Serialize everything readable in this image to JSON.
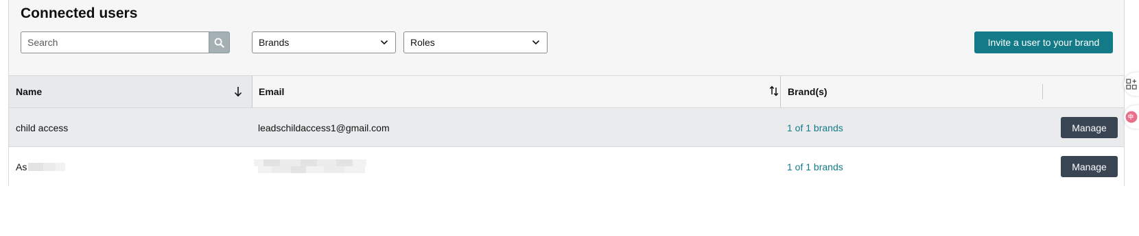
{
  "page": {
    "title": "Connected users"
  },
  "filters": {
    "search_placeholder": "Search",
    "brands_label": "Brands",
    "roles_label": "Roles",
    "invite_label": "Invite a user to your brand"
  },
  "table": {
    "columns": {
      "name": "Name",
      "email": "Email",
      "brands": "Brand(s)"
    },
    "rows": [
      {
        "name": "child access",
        "email": "leadschildaccess1@gmail.com",
        "brands": "1 of 1 brands",
        "action": "Manage"
      },
      {
        "name": "As",
        "email": "",
        "brands": "1 of 1 brands",
        "action": "Manage"
      }
    ]
  },
  "colors": {
    "accent": "#137b88",
    "manage_button": "#3a4553",
    "header_bg": "#f6f6f6",
    "selected_row_bg": "#eaebed"
  },
  "icons": [
    "search-icon",
    "chevron-down-icon",
    "sort-descending-icon",
    "sort-icon",
    "grid-add-icon",
    "translate-icon"
  ]
}
